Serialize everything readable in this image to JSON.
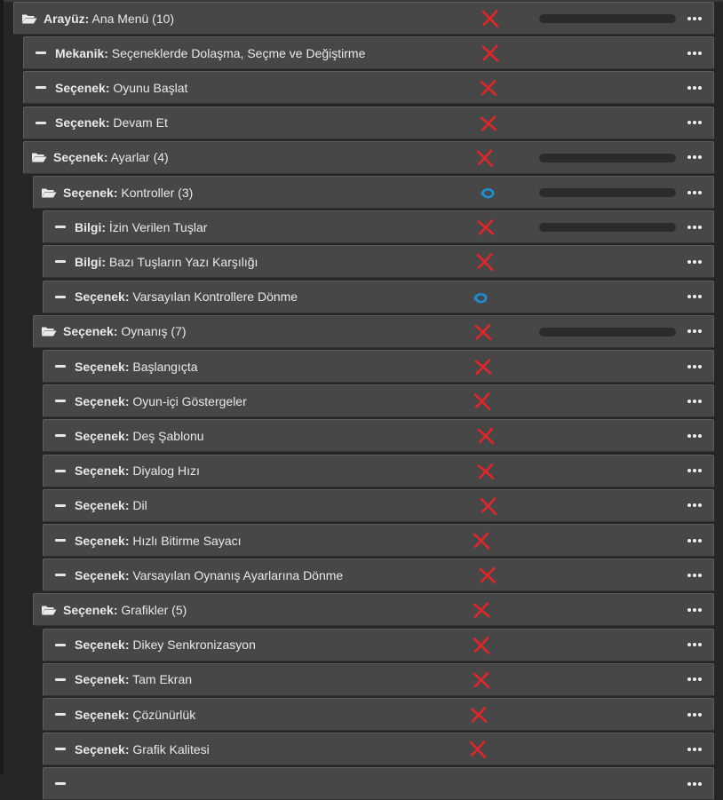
{
  "colors": {
    "accent_red": "#e0262a",
    "accent_blue": "#1a8fd6",
    "row_bg": "#474747"
  },
  "rows": [
    {
      "depth": 0,
      "icon": "folder-open-icon",
      "kind": "Arayüz:",
      "name": "Ana Menü (10)",
      "mark": "cross",
      "progress": 0
    },
    {
      "depth": 1,
      "icon": "dash-icon",
      "kind": "Mekanik:",
      "name": "Seçeneklerde Dolaşma, Seçme ve Değiştirme",
      "mark": "cross"
    },
    {
      "depth": 1,
      "icon": "dash-icon",
      "kind": "Seçenek:",
      "name": "Oyunu Başlat",
      "mark": "cross"
    },
    {
      "depth": 1,
      "icon": "dash-icon",
      "kind": "Seçenek:",
      "name": "Devam Et",
      "mark": "cross"
    },
    {
      "depth": 1,
      "icon": "folder-open-icon",
      "kind": "Seçenek:",
      "name": "Ayarlar (4)",
      "mark": "cross",
      "progress": 0
    },
    {
      "depth": 2,
      "icon": "folder-open-icon",
      "kind": "Seçenek:",
      "name": "Kontroller (3)",
      "mark": "circle",
      "progress": 0
    },
    {
      "depth": 3,
      "icon": "dash-icon",
      "kind": "Bilgi:",
      "name": "İzin Verilen Tuşlar",
      "mark": "cross",
      "progress": 0
    },
    {
      "depth": 3,
      "icon": "dash-icon",
      "kind": "Bilgi:",
      "name": "Bazı Tuşların Yazı Karşılığı",
      "mark": "cross"
    },
    {
      "depth": 3,
      "icon": "dash-icon",
      "kind": "Seçenek:",
      "name": "Varsayılan Kontrollere Dönme",
      "mark": "circle"
    },
    {
      "depth": 2,
      "icon": "folder-open-icon",
      "kind": "Seçenek:",
      "name": "Oynanış (7)",
      "mark": "cross",
      "progress": 0
    },
    {
      "depth": 3,
      "icon": "dash-icon",
      "kind": "Seçenek:",
      "name": "Başlangıçta",
      "mark": "cross"
    },
    {
      "depth": 3,
      "icon": "dash-icon",
      "kind": "Seçenek:",
      "name": "Oyun-içi Göstergeler",
      "mark": "cross"
    },
    {
      "depth": 3,
      "icon": "dash-icon",
      "kind": "Seçenek:",
      "name": "Deş Şablonu",
      "mark": "cross"
    },
    {
      "depth": 3,
      "icon": "dash-icon",
      "kind": "Seçenek:",
      "name": "Diyalog Hızı",
      "mark": "cross"
    },
    {
      "depth": 3,
      "icon": "dash-icon",
      "kind": "Seçenek:",
      "name": "Dil",
      "mark": "cross"
    },
    {
      "depth": 3,
      "icon": "dash-icon",
      "kind": "Seçenek:",
      "name": "Hızlı Bitirme Sayacı",
      "mark": "cross"
    },
    {
      "depth": 3,
      "icon": "dash-icon",
      "kind": "Seçenek:",
      "name": "Varsayılan Oynanış Ayarlarına Dönme",
      "mark": "cross"
    },
    {
      "depth": 2,
      "icon": "folder-open-icon",
      "kind": "Seçenek:",
      "name": "Grafikler (5)",
      "mark": "cross"
    },
    {
      "depth": 3,
      "icon": "dash-icon",
      "kind": "Seçenek:",
      "name": "Dikey Senkronizasyon",
      "mark": "cross"
    },
    {
      "depth": 3,
      "icon": "dash-icon",
      "kind": "Seçenek:",
      "name": "Tam Ekran",
      "mark": "cross"
    },
    {
      "depth": 3,
      "icon": "dash-icon",
      "kind": "Seçenek:",
      "name": "Çözünürlük",
      "mark": "cross"
    },
    {
      "depth": 3,
      "icon": "dash-icon",
      "kind": "Seçenek:",
      "name": "Grafik Kalitesi",
      "mark": "cross"
    },
    {
      "depth": 3,
      "icon": "dash-icon",
      "kind": "",
      "name": "",
      "mark": "none"
    }
  ]
}
